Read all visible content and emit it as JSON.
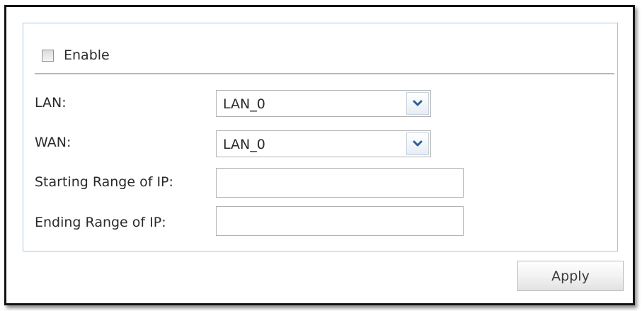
{
  "form": {
    "enable": {
      "label": "Enable",
      "checked": false
    },
    "lan": {
      "label": "LAN:",
      "value": "LAN_0"
    },
    "wan": {
      "label": "WAN:",
      "value": "LAN_0"
    },
    "start_ip": {
      "label": "Starting Range of IP:",
      "value": ""
    },
    "end_ip": {
      "label": "Ending Range of IP:",
      "value": ""
    }
  },
  "actions": {
    "apply_label": "Apply"
  },
  "icons": {
    "dropdown": "chevron-down-icon"
  },
  "colors": {
    "panel_border": "#a9c3e2",
    "chevron": "#2f5f98"
  }
}
